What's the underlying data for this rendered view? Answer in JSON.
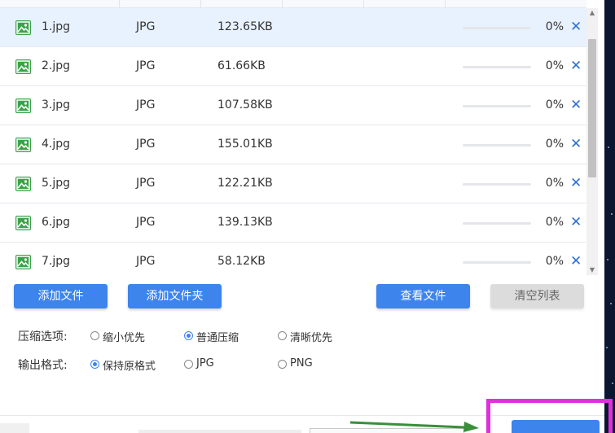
{
  "files": [
    {
      "name": "1.jpg",
      "type": "JPG",
      "size": "123.65KB",
      "progress": 0,
      "progress_text": "0%",
      "remove": "✕",
      "selected": true
    },
    {
      "name": "2.jpg",
      "type": "JPG",
      "size": "61.66KB",
      "progress": 0,
      "progress_text": "0%",
      "remove": "✕",
      "selected": false
    },
    {
      "name": "3.jpg",
      "type": "JPG",
      "size": "107.58KB",
      "progress": 0,
      "progress_text": "0%",
      "remove": "✕",
      "selected": false
    },
    {
      "name": "4.jpg",
      "type": "JPG",
      "size": "155.01KB",
      "progress": 0,
      "progress_text": "0%",
      "remove": "✕",
      "selected": false
    },
    {
      "name": "5.jpg",
      "type": "JPG",
      "size": "122.21KB",
      "progress": 0,
      "progress_text": "0%",
      "remove": "✕",
      "selected": false
    },
    {
      "name": "6.jpg",
      "type": "JPG",
      "size": "139.13KB",
      "progress": 0,
      "progress_text": "0%",
      "remove": "✕",
      "selected": false
    },
    {
      "name": "7.jpg",
      "type": "JPG",
      "size": "58.12KB",
      "progress": 0,
      "progress_text": "0%",
      "remove": "✕",
      "selected": false
    }
  ],
  "buttons": {
    "add_file": "添加文件",
    "add_folder": "添加文件夹",
    "view_files": "查看文件",
    "clear_list": "清空列表"
  },
  "compress": {
    "label": "压缩选项:",
    "options": [
      {
        "label": "缩小优先",
        "checked": false
      },
      {
        "label": "普通压缩",
        "checked": true
      },
      {
        "label": "清晰优先",
        "checked": false
      }
    ]
  },
  "output": {
    "label": "输出格式:",
    "options": [
      {
        "label": "保持原格式",
        "checked": true
      },
      {
        "label": "JPG",
        "checked": false
      },
      {
        "label": "PNG",
        "checked": false
      }
    ]
  },
  "icons": {
    "file": "image-file-icon",
    "remove": "close-icon",
    "scroll_up": "chevron-up-icon",
    "scroll_down": "chevron-down-icon"
  },
  "colors": {
    "accent": "#3d84ec",
    "file_icon": "#3aa34a",
    "remove_icon": "#2f6fd6",
    "selected_row": "#e8f2fe",
    "highlight": "#e12fe0",
    "annotation_arrow": "#3a8f3a"
  }
}
